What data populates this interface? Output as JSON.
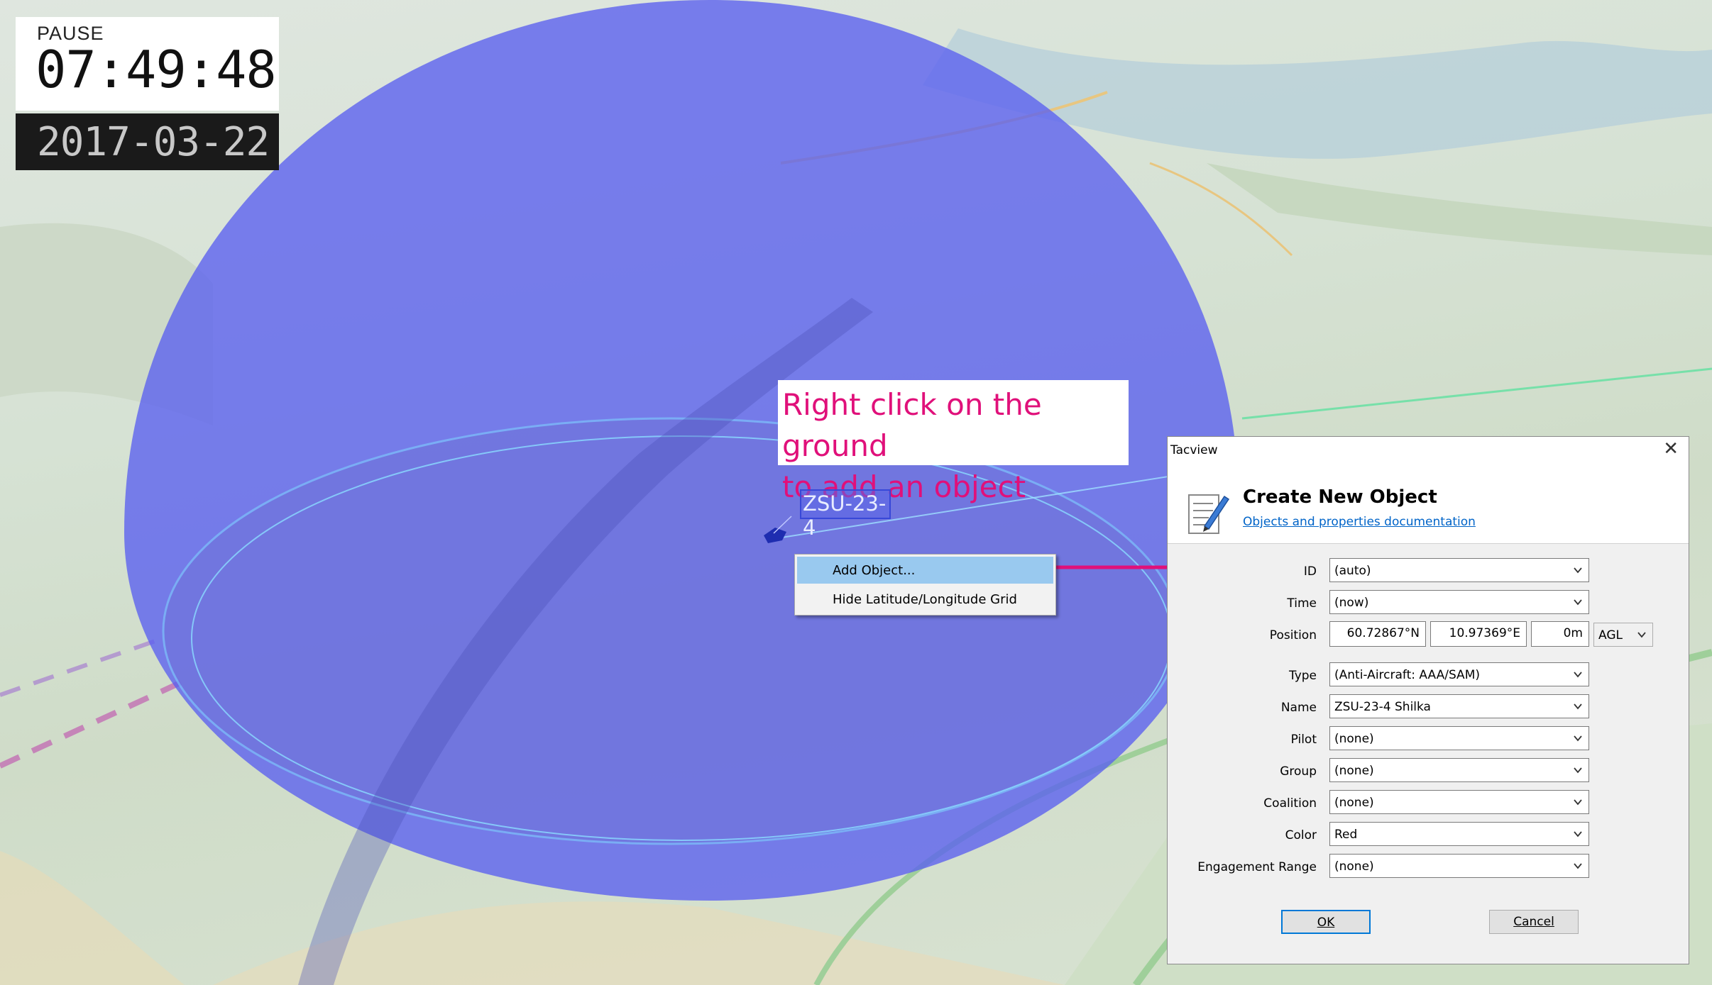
{
  "hud": {
    "status": "PAUSE",
    "time": "07:49:48",
    "date": "2017-03-22"
  },
  "callout": {
    "line1": "Right click on the ground",
    "line2": "to add an object"
  },
  "object_label": "ZSU-23-4",
  "context_menu": {
    "items": [
      {
        "label": "Add Object...",
        "highlighted": true
      },
      {
        "label": "Hide Latitude/Longitude Grid",
        "highlighted": false
      }
    ]
  },
  "dialog": {
    "window_title": "Tacview",
    "heading": "Create New Object",
    "doc_link": "Objects and properties documentation",
    "fields": {
      "id": {
        "label": "ID",
        "value": "(auto)"
      },
      "time": {
        "label": "Time",
        "value": "(now)"
      },
      "position": {
        "label": "Position",
        "latitude": "60.72867°N",
        "longitude": "10.97369°E",
        "altitude": "0m",
        "altitude_ref": "AGL"
      },
      "type": {
        "label": "Type",
        "value": "(Anti-Aircraft: AAA/SAM)"
      },
      "name": {
        "label": "Name",
        "value": "ZSU-23-4 Shilka"
      },
      "pilot": {
        "label": "Pilot",
        "value": "(none)"
      },
      "group": {
        "label": "Group",
        "value": "(none)"
      },
      "coalition": {
        "label": "Coalition",
        "value": "(none)"
      },
      "color": {
        "label": "Color",
        "value": "Red"
      },
      "engagement_range": {
        "label": "Engagement Range",
        "value": "(none)"
      }
    },
    "ok_label": "OK",
    "cancel_label": "Cancel"
  },
  "colors": {
    "dome": "#5a5ff0",
    "callout_text": "#e0107a",
    "arrow": "#e0107a",
    "menu_highlight": "#99c9ef",
    "link": "#0064c8"
  }
}
